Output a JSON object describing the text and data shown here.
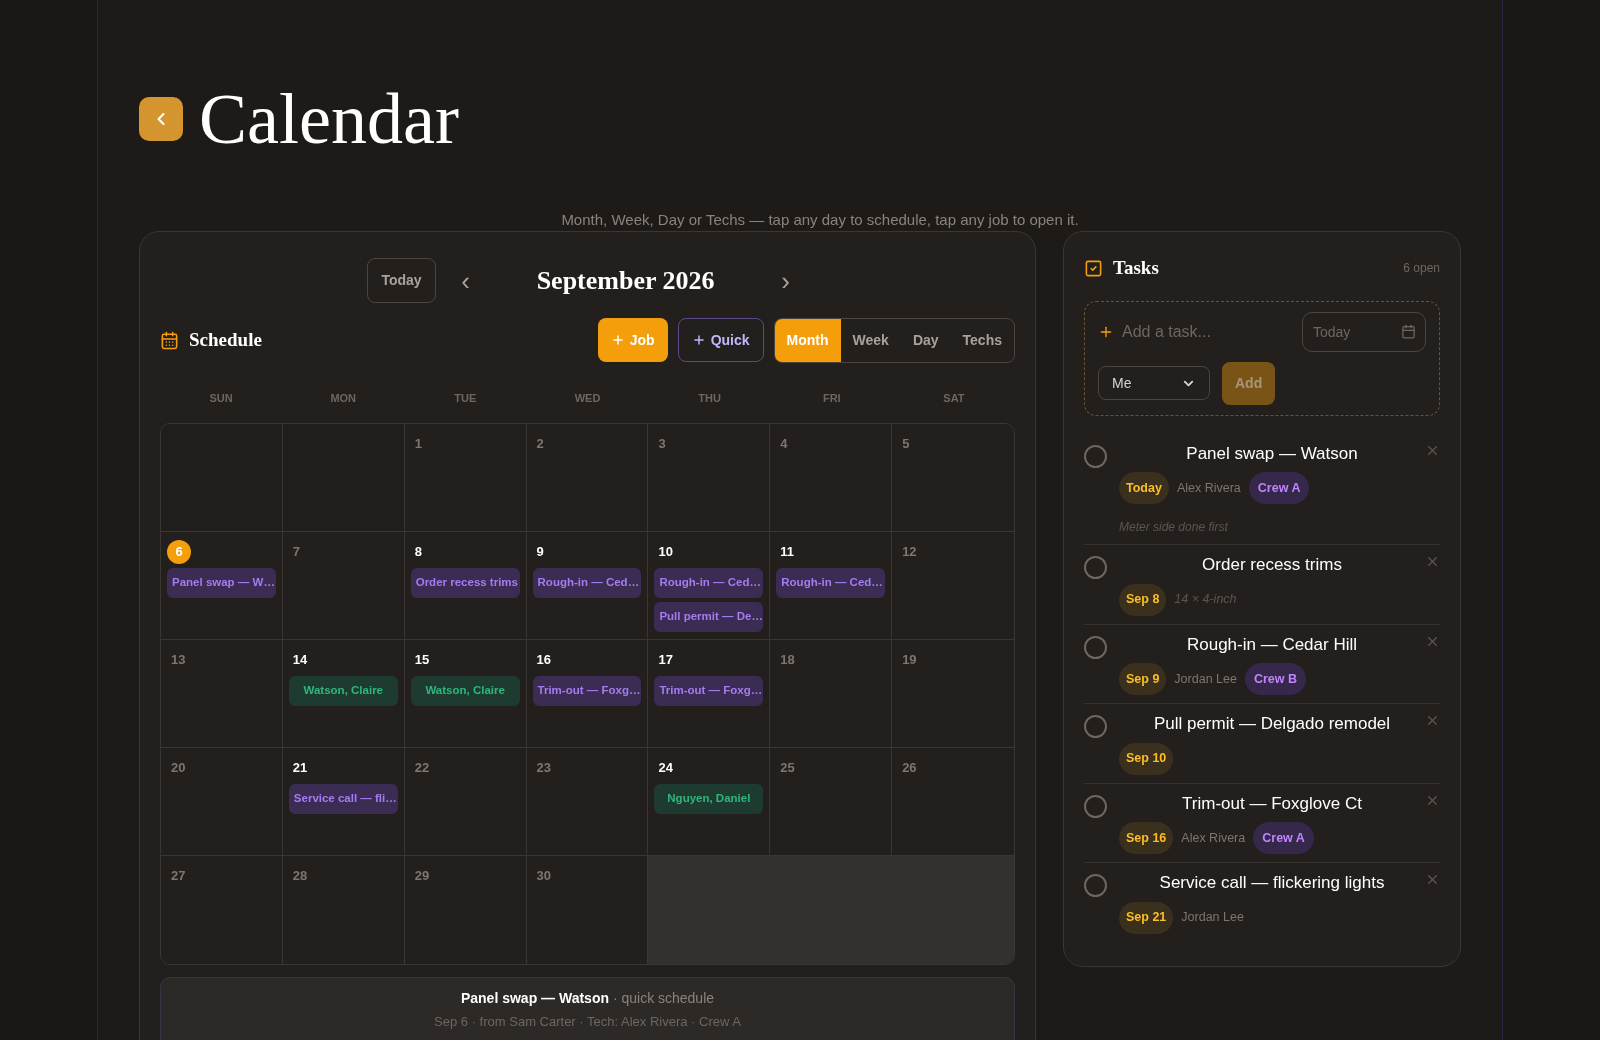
{
  "page": {
    "title": "Calendar",
    "subtitle": "Month, Week, Day or Techs — tap any day to schedule, tap any job to open it."
  },
  "calendar": {
    "today_button": "Today",
    "prev": "‹",
    "month": "September 2026",
    "next": "›",
    "section_title": "Schedule",
    "actions": [
      {
        "label": "Job",
        "kind": "primary"
      },
      {
        "label": "Quick",
        "kind": "outline"
      }
    ],
    "views": [
      {
        "label": "Month",
        "selected": true
      },
      {
        "label": "Week",
        "selected": false
      },
      {
        "label": "Day",
        "selected": false
      },
      {
        "label": "Techs",
        "selected": false
      }
    ],
    "weekdays": [
      "SUN",
      "MON",
      "TUE",
      "WED",
      "THU",
      "FRI",
      "SAT"
    ],
    "cells": [
      {
        "kind": "blank"
      },
      {
        "kind": "blank"
      },
      {
        "kind": "day",
        "day": "1",
        "today": false
      },
      {
        "kind": "day",
        "day": "2",
        "today": false
      },
      {
        "kind": "day",
        "day": "3",
        "today": false
      },
      {
        "kind": "day",
        "day": "4",
        "today": false
      },
      {
        "kind": "day",
        "day": "5",
        "today": false
      },
      {
        "kind": "day",
        "day": "6",
        "today": true,
        "events": [
          {
            "label": "Panel swap — W…",
            "kind": "job"
          }
        ]
      },
      {
        "kind": "day",
        "day": "7",
        "today": false
      },
      {
        "kind": "day",
        "day": "8",
        "today": false,
        "events": [
          {
            "label": "Order recess trims",
            "kind": "job"
          }
        ]
      },
      {
        "kind": "day",
        "day": "9",
        "today": false,
        "events": [
          {
            "label": "Rough-in — Ced…",
            "kind": "job"
          }
        ]
      },
      {
        "kind": "day",
        "day": "10",
        "today": false,
        "events": [
          {
            "label": "Rough-in — Ced…",
            "kind": "job"
          },
          {
            "label": "Pull permit — De…",
            "kind": "job"
          }
        ]
      },
      {
        "kind": "day",
        "day": "11",
        "today": false,
        "events": [
          {
            "label": "Rough-in — Ced…",
            "kind": "job"
          }
        ]
      },
      {
        "kind": "day",
        "day": "12",
        "today": false
      },
      {
        "kind": "day",
        "day": "13",
        "today": false
      },
      {
        "kind": "day",
        "day": "14",
        "today": false,
        "events": [
          {
            "label": "Watson, Claire",
            "kind": "tech"
          }
        ]
      },
      {
        "kind": "day",
        "day": "15",
        "today": false,
        "events": [
          {
            "label": "Watson, Claire",
            "kind": "tech"
          }
        ]
      },
      {
        "kind": "day",
        "day": "16",
        "today": false,
        "events": [
          {
            "label": "Trim-out — Foxg…",
            "kind": "job"
          }
        ]
      },
      {
        "kind": "day",
        "day": "17",
        "today": false,
        "events": [
          {
            "label": "Trim-out — Foxg…",
            "kind": "job"
          }
        ]
      },
      {
        "kind": "day",
        "day": "18",
        "today": false
      },
      {
        "kind": "day",
        "day": "19",
        "today": false
      },
      {
        "kind": "day",
        "day": "20",
        "today": false
      },
      {
        "kind": "day",
        "day": "21",
        "today": false,
        "events": [
          {
            "label": "Service call — fli…",
            "kind": "job"
          }
        ]
      },
      {
        "kind": "day",
        "day": "22",
        "today": false
      },
      {
        "kind": "day",
        "day": "23",
        "today": false
      },
      {
        "kind": "day",
        "day": "24",
        "today": false,
        "events": [
          {
            "label": "Nguyen, Daniel",
            "kind": "tech"
          }
        ]
      },
      {
        "kind": "day",
        "day": "25",
        "today": false
      },
      {
        "kind": "day",
        "day": "26",
        "today": false
      },
      {
        "kind": "day",
        "day": "27",
        "today": false
      },
      {
        "kind": "day",
        "day": "28",
        "today": false
      },
      {
        "kind": "day",
        "day": "29",
        "today": false
      },
      {
        "kind": "day",
        "day": "30",
        "today": false
      },
      {
        "kind": "filler"
      }
    ],
    "pending": {
      "title": "Panel swap — Watson",
      "suffix": "· quick schedule",
      "detail": "Sep 6 · from Sam Carter · Tech: Alex Rivera · Crew A"
    }
  },
  "tasks": {
    "title": "Tasks",
    "count": "6 open",
    "add": {
      "placeholder": "Add a task...",
      "date_placeholder": "Today",
      "assignee": "Me",
      "button": "Add"
    },
    "items": [
      {
        "title": "Panel swap — Watson",
        "checked": false,
        "due": "Today",
        "assignee": "Alex Rivera",
        "crew": "Crew A",
        "note": "Meter side done first"
      },
      {
        "title": "Order recess trims",
        "checked": false,
        "due": "Sep 8",
        "note": "14 × 4-inch"
      },
      {
        "title": "Rough-in — Cedar Hill",
        "checked": false,
        "due": "Sep 9",
        "assignee": "Jordan Lee",
        "crew": "Crew B"
      },
      {
        "title": "Pull permit — Delgado remodel",
        "checked": false,
        "due": "Sep 10"
      },
      {
        "title": "Trim-out — Foxglove Ct",
        "checked": false,
        "due": "Sep 16",
        "assignee": "Alex Rivera",
        "crew": "Crew A"
      },
      {
        "title": "Service call — flickering lights",
        "checked": false,
        "due": "Sep 21",
        "assignee": "Jordan Lee"
      }
    ]
  }
}
